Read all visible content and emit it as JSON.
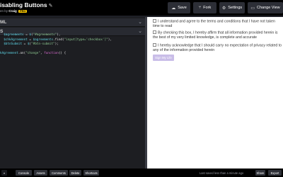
{
  "header": {
    "title": "isabling Buttons",
    "byline_prefix": "en by",
    "author": "Craig",
    "pro_badge": "PRO",
    "buttons": {
      "save": "Save",
      "fork": "Fork",
      "settings": "Settings",
      "change_view": "Change View"
    }
  },
  "editor": {
    "panes": [
      {
        "label": "ML"
      },
      {
        "label": "S"
      }
    ],
    "code_lines": [
      {
        "parts": [
          {
            "t": "  "
          },
          {
            "t": "$agreements",
            "c": "v"
          },
          {
            "t": " = "
          },
          {
            "t": "$",
            "c": "v"
          },
          {
            "t": "("
          },
          {
            "t": "\"#agreements\"",
            "c": "s"
          },
          {
            "t": "),"
          }
        ]
      },
      {
        "parts": [
          {
            "t": "  "
          },
          {
            "t": "$chkAgreement",
            "c": "v"
          },
          {
            "t": " = "
          },
          {
            "t": "$agreements",
            "c": "v"
          },
          {
            "t": ".find("
          },
          {
            "t": "\"input[type='checkbox']\"",
            "c": "s"
          },
          {
            "t": "),"
          }
        ]
      },
      {
        "parts": [
          {
            "t": "  "
          },
          {
            "t": "$btnSubmit",
            "c": "v"
          },
          {
            "t": " = "
          },
          {
            "t": "$",
            "c": "v"
          },
          {
            "t": "("
          },
          {
            "t": "\"#btn-submit\"",
            "c": "s"
          },
          {
            "t": ");"
          }
        ]
      },
      {
        "parts": []
      },
      {
        "parts": [
          {
            "t": "kAgreement",
            "c": "v"
          },
          {
            "t": ".on("
          },
          {
            "t": "\"change\"",
            "c": "s"
          },
          {
            "t": ", "
          },
          {
            "t": "function",
            "c": "k"
          },
          {
            "t": "() {"
          }
        ]
      }
    ]
  },
  "preview": {
    "agreements": [
      "I understand and agree to the terms and conditions that I have not taken time to read",
      "By checking this box, I hereby affirm that all information provided herein is the best of my very limited knowledge, is complete and accurate",
      "I hereby acknowledge that I should carry no expectation of privacy related to any of the information provided herein"
    ],
    "submit_label": "Sign My Life"
  },
  "footer": {
    "buttons": [
      "Console",
      "Assets",
      "Comments",
      "Delete",
      "Shortcuts"
    ],
    "status": "Last saved less than a minute ago",
    "share": "Share",
    "export": "Export"
  },
  "colors": {
    "accent_purple": "#c9bde8",
    "pro_yellow": "#f6c500",
    "code_variable": "#5fd7e8",
    "code_string": "#8dc891",
    "code_keyword": "#dd6bd4"
  }
}
